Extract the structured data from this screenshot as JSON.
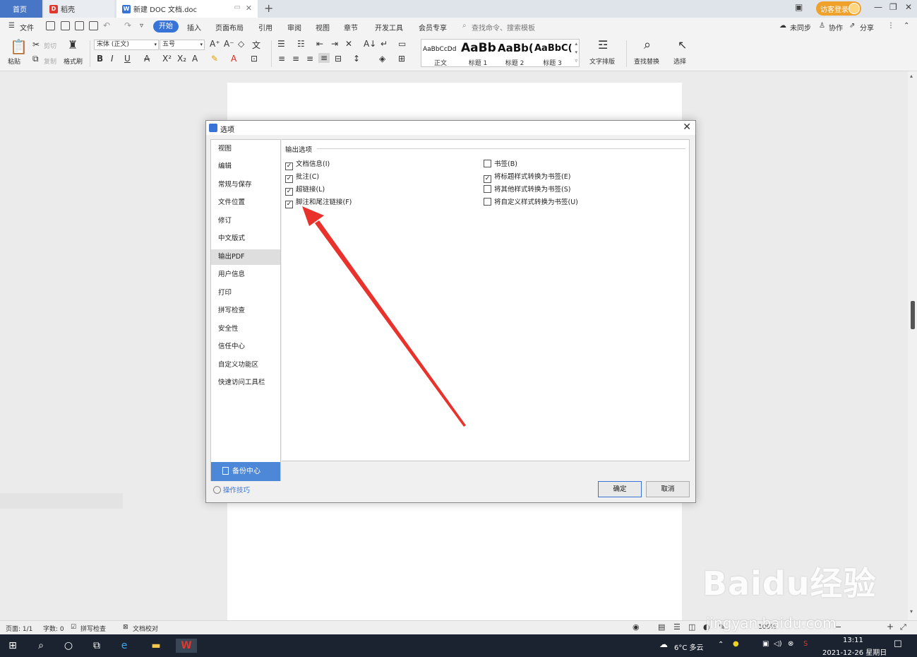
{
  "tabs": {
    "home": "首页",
    "daoke": "稻壳",
    "doc": "新建 DOC 文档.doc",
    "guest_login": "访客登录"
  },
  "menu": {
    "file": "文件",
    "items": [
      "开始",
      "插入",
      "页面布局",
      "引用",
      "审阅",
      "视图",
      "章节",
      "开发工具",
      "会员专享"
    ],
    "search_placeholder": "查找命令、搜索模板",
    "sync": "未同步",
    "collab": "协作",
    "share": "分享"
  },
  "ribbon": {
    "paste": "粘贴",
    "cut": "剪切",
    "copy": "复制",
    "format_painter": "格式刷",
    "font_name": "宋体 (正文)",
    "font_size": "五号",
    "styles": [
      {
        "sample": "AaBbCcDd",
        "name": "正文"
      },
      {
        "sample": "AaBb",
        "name": "标题 1"
      },
      {
        "sample": "AaBb(",
        "name": "标题 2"
      },
      {
        "sample": "AaBbC(",
        "name": "标题 3"
      }
    ],
    "text_layout": "文字排版",
    "find_replace": "查找替换",
    "select": "选择"
  },
  "dialog": {
    "title": "选项",
    "nav": [
      "视图",
      "编辑",
      "常规与保存",
      "文件位置",
      "修订",
      "中文版式",
      "输出PDF",
      "用户信息",
      "打印",
      "拼写检查",
      "安全性",
      "信任中心",
      "自定义功能区",
      "快速访问工具栏"
    ],
    "active_nav": "输出PDF",
    "backup": "备份中心",
    "tips": "操作技巧",
    "group_title": "输出选项",
    "options_left": [
      {
        "label": "文档信息(I)",
        "checked": true
      },
      {
        "label": "批注(C)",
        "checked": true
      },
      {
        "label": "超链接(L)",
        "checked": true
      },
      {
        "label": "脚注和尾注链接(F)",
        "checked": true
      }
    ],
    "options_right": [
      {
        "label": "书签(B)",
        "checked": false
      },
      {
        "label": "将标题样式转换为书签(E)",
        "checked": true
      },
      {
        "label": "将其他样式转换为书签(S)",
        "checked": false
      },
      {
        "label": "将自定义样式转换为书签(U)",
        "checked": false
      }
    ],
    "ok": "确定",
    "cancel": "取消"
  },
  "status": {
    "page": "页面: 1/1",
    "words": "字数: 0",
    "spell": "拼写检查",
    "proof": "文档校对",
    "zoom": "100%"
  },
  "taskbar": {
    "weather": "6°C 多云",
    "time": "13:11",
    "date": "2021-12-26 星期日"
  },
  "watermark": {
    "text": "Baidu经验",
    "url": "jingyan.baidu.com"
  },
  "colors": {
    "accent": "#3873d8",
    "arrow": "#e8322b",
    "guest": "#f0a12c"
  }
}
